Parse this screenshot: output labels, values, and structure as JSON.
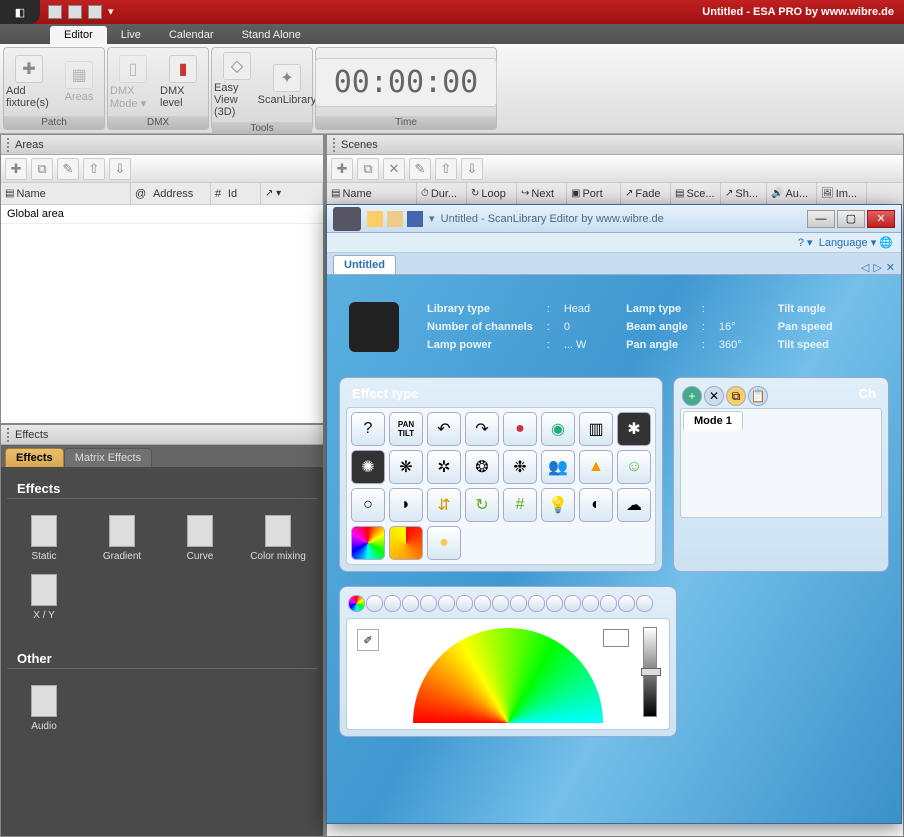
{
  "titlebar": {
    "title": "Untitled - ESA PRO    by www.wibre.de"
  },
  "maintabs": {
    "t0": "Editor",
    "t1": "Live",
    "t2": "Calendar",
    "t3": "Stand Alone"
  },
  "ribbon": {
    "patch": {
      "label": "Patch",
      "add": "Add fixture(s)",
      "areas": "Areas"
    },
    "dmx": {
      "label": "DMX",
      "mode": "DMX Mode ▾",
      "level": "DMX level"
    },
    "tools": {
      "label": "Tools",
      "easy": "Easy View (3D)",
      "scan": "ScanLibrary"
    },
    "time": {
      "label": "Time",
      "value": "00:00:00"
    }
  },
  "areas_panel": {
    "title": "Areas",
    "cols": {
      "name": "Name",
      "address": "Address",
      "id": "Id"
    },
    "prefix_at": "@",
    "prefix_hash": "#",
    "rows": {
      "r0": "Global area"
    }
  },
  "scenes_panel": {
    "title": "Scenes",
    "cols": {
      "name": "Name",
      "dur": "Dur...",
      "loop": "Loop",
      "next": "Next",
      "port": "Port",
      "fade": "Fade",
      "sce": "Sce...",
      "sh": "Sh...",
      "au": "Au...",
      "im": "Im..."
    }
  },
  "effects_panel": {
    "title": "Effects",
    "tab_effects": "Effects",
    "tab_matrix": "Matrix Effects",
    "sec_effects": "Effects",
    "sec_other": "Other",
    "items": {
      "static": "Static",
      "gradient": "Gradient",
      "curve": "Curve",
      "colormix": "Color mixing",
      "xy": "X / Y",
      "audio": "Audio"
    }
  },
  "scanlib": {
    "title": "Untitled - ScanLibrary Editor    by www.wibre.de",
    "language": "Language",
    "help": "? ▾",
    "doc_tab": "Untitled",
    "info": {
      "libtype_l": "Library type",
      "libtype_v": "Head",
      "chans_l": "Number of channels",
      "chans_v": "0",
      "power_l": "Lamp power",
      "power_v": "... W",
      "lamptype_l": "Lamp type",
      "lamptype_v": "",
      "beam_l": "Beam angle",
      "beam_v": "16°",
      "pan_l": "Pan angle",
      "pan_v": "360°",
      "tiltang_l": "Tilt angle",
      "panspd_l": "Pan speed",
      "tiltspd_l": "Tilt speed"
    },
    "effect_type": "Effect type",
    "ch_label": "Ch",
    "mode1": "Mode 1",
    "icons": {
      "i0": "?",
      "i1": "PAN TILT",
      "i2": "↶",
      "i3": "↷",
      "i4": "●",
      "i5": "◉",
      "i6": "▥",
      "i7": "✱",
      "i8": "✺",
      "i9": "❋",
      "i10": "✲",
      "i11": "❂",
      "i12": "❉",
      "i13": "👥",
      "i14": "▲",
      "i15": "☺",
      "i16": "○",
      "i17": "◗",
      "i18": "⇵",
      "i19": "↻",
      "i20": "#",
      "i21": "💡",
      "i22": "◐",
      "i23": "☁",
      "i24": "◕",
      "i25": "◔",
      "i26": "●"
    }
  }
}
